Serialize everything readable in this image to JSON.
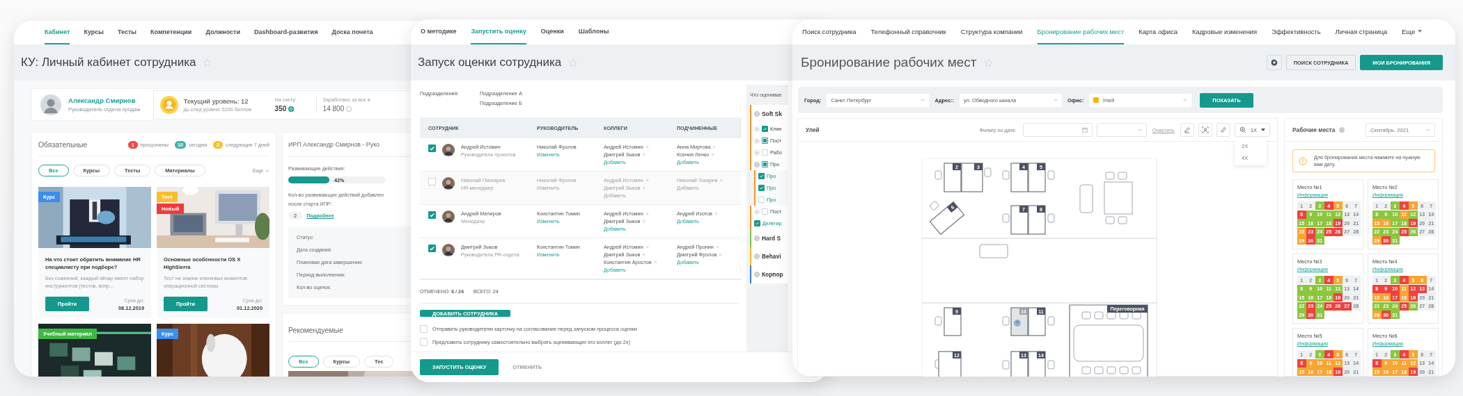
{
  "cabinet": {
    "tabs": [
      {
        "label": "Кабинет",
        "selected": true
      },
      {
        "label": "Курсы",
        "selected": false
      },
      {
        "label": "Тесты",
        "selected": false
      },
      {
        "label": "Компетенции",
        "selected": false
      },
      {
        "label": "Должности",
        "selected": false
      },
      {
        "label": "Dashboard-развития",
        "selected": false
      },
      {
        "label": "Доска почета",
        "selected": false
      }
    ],
    "title": "КУ: Личный кабинет сотрудника",
    "profile": {
      "name": "Александр Смирнов",
      "position": "Руководитель отдела продаж"
    },
    "level": {
      "title": "Текущий уровень: 12",
      "hint": "до след уровня: 5200 баллов",
      "balance_label": "На счету:",
      "balance": "350",
      "earned_label": "Заработано за все в",
      "earned": "14 800"
    },
    "required": {
      "title": "Обязательные",
      "counters": [
        {
          "count": "1",
          "label": "просрочены",
          "color": "#f04a3e"
        },
        {
          "count": "10",
          "label": "сегодня",
          "color": "#3fb3a6"
        },
        {
          "count": "2",
          "label": "следующие 7 дней",
          "color": "#f6c22e"
        }
      ],
      "filters": [
        {
          "label": "Все",
          "selected": true
        },
        {
          "label": "Курсы",
          "selected": false
        },
        {
          "label": "Тесты",
          "selected": false
        },
        {
          "label": "Материалы",
          "selected": false
        }
      ],
      "more": "Еще",
      "cards": [
        {
          "kind": "full",
          "tags": [
            {
              "label": "Курс",
              "color": "#3a8ef0"
            }
          ],
          "title": "На что стоит обратить внимание HR специалисту при подборе?",
          "text": "Без сомнений, каждый эйчар имеет набор инструментов (тестов, вопр...",
          "button": "Пройти",
          "due_label": "Срок до:",
          "due": "08.12.2019"
        },
        {
          "kind": "full",
          "tags": [
            {
              "label": "Тест",
              "color": "#f7be2f"
            },
            {
              "label": "Новый",
              "color": "#ef3b3b"
            }
          ],
          "title": "Основные особенности OS X HighSierra",
          "text": "Тест на знание ключевых моментов операционной системы",
          "button": "Пройти",
          "due_label": "Срок до:",
          "due": "01.12.2020"
        },
        {
          "kind": "picture",
          "tags": [
            {
              "label": "Учебный материал",
              "color": "#3db843"
            }
          ]
        },
        {
          "kind": "picture",
          "tags": [
            {
              "label": "Курс",
              "color": "#3a8ef0"
            }
          ]
        }
      ]
    },
    "plan": {
      "title": "ИРП Александр Смирнов - Руко",
      "actions_label": "Развивающие действия:",
      "level": 0.42,
      "percent": "42%",
      "added_lines": [
        "Кол-во развивающих действий добавлен",
        "после старта ИПР:"
      ],
      "added_count": "2",
      "more_link": "Подробнее",
      "fields": [
        "Статус:",
        "Дата создания:",
        "Плановая дата завершения:",
        "Период выполнения:",
        "Кол-во оценок:"
      ]
    },
    "recommended": {
      "title": "Рекомендуемые",
      "filters": [
        {
          "label": "Все",
          "selected": true
        },
        {
          "label": "Курсы",
          "selected": false
        },
        {
          "label": "Тес",
          "selected": false
        }
      ]
    }
  },
  "assessment": {
    "tabs": [
      {
        "label": "О методике",
        "selected": false
      },
      {
        "label": "Запустить оценку",
        "selected": true
      },
      {
        "label": "Оценки",
        "selected": false
      },
      {
        "label": "Шаблоны",
        "selected": false
      }
    ],
    "title": "Запуск оценки сотрудника",
    "departments_label": "Подразделения:",
    "departments": [
      "Подразделение А",
      "Подразделение Б"
    ],
    "columns": [
      "СОТРУДНИК",
      "РУКОВОДИТЕЛЬ",
      "КОЛЛЕГИ",
      "ПОДЧИНЕННЫЕ"
    ],
    "rows": [
      {
        "checked": true,
        "name": "Андрей Истомин",
        "position": "Руководитель проектов",
        "manager": "Николай Фролов",
        "change": "Изменить",
        "colleagues": [
          "Андрей Истомин",
          "Дмитрий Зыков"
        ],
        "colleagues_add": "Добавить",
        "subordinates": [
          "Анна Миртова",
          "Ксения Ленко"
        ],
        "subordinates_add": "Добавить"
      },
      {
        "checked": false,
        "name": "Николай Пискарев",
        "position": "HR-менеджер",
        "manager": "Николай Фролов",
        "change": "Изменить",
        "colleagues": [
          "Андрей Истомин",
          "Дмитрий Зыков"
        ],
        "colleagues_add": "Добавить",
        "subordinates": [
          "Николай Токарев"
        ],
        "subordinates_add": "Добавить"
      },
      {
        "checked": true,
        "name": "Андрей Мелиров",
        "position": "Менеджер",
        "manager": "Константин Томин",
        "change": "Изменить",
        "colleagues": [
          "Андрей Истомин",
          "Дмитрий Зыков"
        ],
        "colleagues_add": "Добавить",
        "subordinates": [
          "Андрей Изотов"
        ],
        "subordinates_add": "Добавить"
      },
      {
        "checked": true,
        "name": "Дмитрий Зыков",
        "position": "Руководитель PR-отдела",
        "manager": "Константин Томин",
        "change": "Изменить",
        "colleagues": [
          "Андрей Истомин",
          "Дмитрий Зыков",
          "Константин Аростов"
        ],
        "colleagues_add": "Добавить",
        "subordinates": [
          "Андрей Пронин",
          "Дмитрий Фролов"
        ],
        "subordinates_add": "Добавить"
      }
    ],
    "marked": "ОТМЕЧЕНО: **6 / 24**",
    "total": "ВСЕГО: 24",
    "add_button": "ДОБАВИТЬ СОТРУДНИКА",
    "options": [
      {
        "label": "Отправить руководителю карточку на согласование перед запуском процесса оценки",
        "checked": false
      },
      {
        "label": "Предложить сотруднику самостоятельно выбрать оценивающих его коллег (до 2х)",
        "checked": false
      }
    ],
    "start_button": "ЗАПУСТИТЬ ОЦЕНКУ",
    "cancel_button": "ОТМЕНИТЬ",
    "criteria": {
      "title": "Что оценивае",
      "groups": [
        {
          "label": "Soft Sk",
          "color": "#f7941d",
          "expanded": true,
          "children": [
            {
              "label": "Клие",
              "expanded": false,
              "checked": true
            },
            {
              "label": "Пост",
              "expanded": false,
              "checked": false,
              "partial": true
            },
            {
              "label": "Рабо",
              "expanded": false,
              "checked": false,
              "partial": false
            },
            {
              "label": "Про",
              "expanded": true,
              "checked": false,
              "partial": true,
              "children": [
                {
                  "label": "Про",
                  "checked": true
                },
                {
                  "label": "Про",
                  "checked": true
                },
                {
                  "label": "Про",
                  "checked": false,
                  "partial": false
                }
              ]
            },
            {
              "label": "Пост",
              "expanded": false,
              "checked": false,
              "partial": false
            },
            {
              "label": "Делегир",
              "checked": true
            }
          ]
        },
        {
          "label": "Hard S",
          "color": "#7cc242",
          "expanded": true
        },
        {
          "label": "Behavi",
          "color": "#f9b91d",
          "expanded": true
        },
        {
          "label": "Корпор",
          "color": "#3d7be0",
          "expanded": true
        }
      ]
    }
  },
  "booking": {
    "tabs": [
      {
        "label": "Поиск сотрудника",
        "selected": false
      },
      {
        "label": "Телефонный справочник",
        "selected": false
      },
      {
        "label": "Структура компании",
        "selected": false
      },
      {
        "label": "Бронирование рабочих мест",
        "selected": true
      },
      {
        "label": "Карта офиса",
        "selected": false
      },
      {
        "label": "Кадровые изменения",
        "selected": false
      },
      {
        "label": "Эффективность",
        "selected": false
      },
      {
        "label": "Личная страница",
        "selected": false
      },
      {
        "label": "Еще",
        "selected": false
      }
    ],
    "title": "Бронирование рабочих мест",
    "search_button": "ПОИСК СОТРУДНИКА",
    "bookings_button": "МОИ БРОНИРОВАНИЯ",
    "filters": [
      {
        "label": "Город:",
        "value": "Санкт-Петербург"
      },
      {
        "label": "Адрес::",
        "value": "ул. Обводного канала"
      },
      {
        "label": "Офис:",
        "value": "Улей",
        "color": "#f7b500"
      }
    ],
    "show_button": "ПОКАЗАТЬ",
    "map": {
      "title": "Улей",
      "date_label": "Фильтр по дате:",
      "clear": "Очистить",
      "zoom": "1X",
      "zoom_options": [
        "2X",
        "4X"
      ],
      "desks": [
        {
          "number": "2",
          "occupied": false
        },
        {
          "number": "3",
          "occupied": false
        },
        {
          "number": "4",
          "occupied": false
        },
        {
          "number": "5",
          "occupied": false
        },
        {
          "number": "6",
          "occupied": false
        },
        {
          "number": "7",
          "occupied": false
        },
        {
          "number": "8",
          "occupied": false
        },
        {
          "number": "9",
          "occupied": false
        },
        {
          "number": "10",
          "occupied": true
        },
        {
          "number": "11",
          "occupied": false
        },
        {
          "number": "12",
          "occupied": false
        },
        {
          "number": "13",
          "occupied": false
        },
        {
          "number": "14",
          "occupied": false
        }
      ],
      "meeting_room": "Переговорная"
    },
    "sidebar": {
      "title": "Рабочие места",
      "month": "Сентябрь, 2021",
      "notice": "Для бронирования места нажмите на нужную вам дату.",
      "places": [
        {
          "title": "Место №1",
          "link": "Информация",
          "days": [
            {
              "d": "1",
              "color": "#eef0f2"
            },
            {
              "d": "2",
              "color": "#eef0f2"
            },
            {
              "d": "3",
              "color": "#8cc63f"
            },
            {
              "d": "4",
              "color": "#f0413f"
            },
            {
              "d": "5",
              "color": "#f8a531"
            },
            {
              "d": "6",
              "color": "#eef0f2"
            },
            {
              "d": "7",
              "color": "#eef0f2"
            },
            {
              "d": "8",
              "color": "#f0413f"
            },
            {
              "d": "9",
              "color": "#8cc63f"
            },
            {
              "d": "10",
              "color": "#8cc63f"
            },
            {
              "d": "11",
              "color": "#8cc63f"
            },
            {
              "d": "12",
              "color": "#8cc63f"
            },
            {
              "d": "13",
              "color": "#eef0f2"
            },
            {
              "d": "14",
              "color": "#eef0f2"
            },
            {
              "d": "15",
              "color": "#8cc63f"
            },
            {
              "d": "16",
              "color": "#8cc63f"
            },
            {
              "d": "17",
              "color": "#8cc63f"
            },
            {
              "d": "18",
              "color": "#8cc63f"
            },
            {
              "d": "19",
              "color": "#f0413f"
            },
            {
              "d": "20",
              "color": "#eef0f2"
            },
            {
              "d": "21",
              "color": "#eef0f2"
            },
            {
              "d": "22",
              "color": "#f8a531"
            },
            {
              "d": "23",
              "color": "#f0413f"
            },
            {
              "d": "24",
              "color": "#8cc63f"
            },
            {
              "d": "25",
              "color": "#f0413f"
            },
            {
              "d": "26",
              "color": "#f0413f"
            },
            {
              "d": "27",
              "color": "#eef0f2"
            },
            {
              "d": "28",
              "color": "#eef0f2"
            },
            {
              "d": "29",
              "color": "#f8a531"
            },
            {
              "d": "30",
              "color": "#f0413f"
            },
            {
              "d": "31",
              "color": "#8cc63f"
            }
          ]
        },
        {
          "title": "Место №2",
          "link": "Информация",
          "days": [
            {
              "d": "1",
              "color": "#eef0f2"
            },
            {
              "d": "2",
              "color": "#eef0f2"
            },
            {
              "d": "3",
              "color": "#8cc63f"
            },
            {
              "d": "4",
              "color": "#f0413f"
            },
            {
              "d": "5",
              "color": "#f8a531"
            },
            {
              "d": "6",
              "color": "#eef0f2"
            },
            {
              "d": "7",
              "color": "#eef0f2"
            },
            {
              "d": "8",
              "color": "#8cc63f"
            },
            {
              "d": "9",
              "color": "#8cc63f"
            },
            {
              "d": "10",
              "color": "#8cc63f"
            },
            {
              "d": "11",
              "color": "#f8a531"
            },
            {
              "d": "12",
              "color": "#8cc63f"
            },
            {
              "d": "13",
              "color": "#eef0f2"
            },
            {
              "d": "14",
              "color": "#eef0f2"
            },
            {
              "d": "15",
              "color": "#f8a531"
            },
            {
              "d": "16",
              "color": "#f8a531"
            },
            {
              "d": "17",
              "color": "#8cc63f"
            },
            {
              "d": "18",
              "color": "#8cc63f"
            },
            {
              "d": "19",
              "color": "#f0413f"
            },
            {
              "d": "20",
              "color": "#eef0f2"
            },
            {
              "d": "21",
              "color": "#eef0f2"
            },
            {
              "d": "22",
              "color": "#8cc63f"
            },
            {
              "d": "23",
              "color": "#8cc63f"
            },
            {
              "d": "24",
              "color": "#8cc63f"
            },
            {
              "d": "25",
              "color": "#f0413f"
            },
            {
              "d": "26",
              "color": "#8cc63f"
            },
            {
              "d": "27",
              "color": "#eef0f2"
            },
            {
              "d": "28",
              "color": "#eef0f2"
            },
            {
              "d": "29",
              "color": "#f8a531"
            },
            {
              "d": "30",
              "color": "#f0413f"
            },
            {
              "d": "31",
              "color": "#8cc63f"
            }
          ]
        },
        {
          "title": "Место №3",
          "link": "Информация",
          "days": [
            {
              "d": "1",
              "color": "#eef0f2"
            },
            {
              "d": "2",
              "color": "#eef0f2"
            },
            {
              "d": "3",
              "color": "#8cc63f"
            },
            {
              "d": "4",
              "color": "#f0413f"
            },
            {
              "d": "5",
              "color": "#f8a531"
            },
            {
              "d": "6",
              "color": "#eef0f2"
            },
            {
              "d": "7",
              "color": "#eef0f2"
            },
            {
              "d": "8",
              "color": "#8cc63f"
            },
            {
              "d": "9",
              "color": "#8cc63f"
            },
            {
              "d": "10",
              "color": "#8cc63f"
            },
            {
              "d": "11",
              "color": "#8cc63f"
            },
            {
              "d": "12",
              "color": "#8cc63f"
            },
            {
              "d": "13",
              "color": "#eef0f2"
            },
            {
              "d": "14",
              "color": "#eef0f2"
            },
            {
              "d": "15",
              "color": "#8cc63f"
            },
            {
              "d": "16",
              "color": "#8cc63f"
            },
            {
              "d": "17",
              "color": "#8cc63f"
            },
            {
              "d": "18",
              "color": "#8cc63f"
            },
            {
              "d": "19",
              "color": "#f0413f"
            },
            {
              "d": "20",
              "color": "#eef0f2"
            },
            {
              "d": "21",
              "color": "#eef0f2"
            },
            {
              "d": "22",
              "color": "#8cc63f"
            },
            {
              "d": "23",
              "color": "#f0413f"
            },
            {
              "d": "24",
              "color": "#8cc63f"
            },
            {
              "d": "25",
              "color": "#f0413f"
            },
            {
              "d": "26",
              "color": "#f0413f"
            },
            {
              "d": "27",
              "color": "#f0413f"
            },
            {
              "d": "28",
              "color": "#eef0f2"
            },
            {
              "d": "29",
              "color": "#8cc63f"
            },
            {
              "d": "30",
              "color": "#f0413f"
            },
            {
              "d": "31",
              "color": "#8cc63f"
            }
          ]
        },
        {
          "title": "Место №4",
          "link": "Информация",
          "days": [
            {
              "d": "1",
              "color": "#eef0f2"
            },
            {
              "d": "2",
              "color": "#eef0f2"
            },
            {
              "d": "3",
              "color": "#8cc63f"
            },
            {
              "d": "4",
              "color": "#f0413f"
            },
            {
              "d": "5",
              "color": "#f8a531"
            },
            {
              "d": "6",
              "color": "#f8a531"
            },
            {
              "d": "7",
              "color": "#eef0f2"
            },
            {
              "d": "8",
              "color": "#f0413f"
            },
            {
              "d": "9",
              "color": "#f0413f"
            },
            {
              "d": "10",
              "color": "#f0413f"
            },
            {
              "d": "11",
              "color": "#f8a531"
            },
            {
              "d": "12",
              "color": "#f0413f"
            },
            {
              "d": "13",
              "color": "#f0413f"
            },
            {
              "d": "14",
              "color": "#eef0f2"
            },
            {
              "d": "15",
              "color": "#f8a531"
            },
            {
              "d": "16",
              "color": "#f8a531"
            },
            {
              "d": "17",
              "color": "#f0413f"
            },
            {
              "d": "18",
              "color": "#f8a531"
            },
            {
              "d": "19",
              "color": "#f0413f"
            },
            {
              "d": "20",
              "color": "#eef0f2"
            },
            {
              "d": "21",
              "color": "#eef0f2"
            },
            {
              "d": "22",
              "color": "#8cc63f"
            },
            {
              "d": "23",
              "color": "#8cc63f"
            },
            {
              "d": "24",
              "color": "#8cc63f"
            },
            {
              "d": "25",
              "color": "#f0413f"
            },
            {
              "d": "26",
              "color": "#8cc63f"
            },
            {
              "d": "27",
              "color": "#eef0f2"
            },
            {
              "d": "28",
              "color": "#eef0f2"
            },
            {
              "d": "29",
              "color": "#f8a531"
            },
            {
              "d": "30",
              "color": "#f0413f"
            },
            {
              "d": "31",
              "color": "#8cc63f"
            }
          ]
        },
        {
          "title": "Место №5",
          "link": "Информация",
          "days": [
            {
              "d": "1",
              "color": "#eef0f2"
            },
            {
              "d": "2",
              "color": "#eef0f2"
            },
            {
              "d": "3",
              "color": "#8cc63f"
            },
            {
              "d": "4",
              "color": "#f0413f"
            },
            {
              "d": "5",
              "color": "#f8a531"
            },
            {
              "d": "6",
              "color": "#eef0f2"
            },
            {
              "d": "7",
              "color": "#eef0f2"
            },
            {
              "d": "8",
              "color": "#f0413f"
            },
            {
              "d": "9",
              "color": "#f8a531"
            },
            {
              "d": "10",
              "color": "#f8a531"
            },
            {
              "d": "11",
              "color": "#f8a531"
            },
            {
              "d": "12",
              "color": "#f8a531"
            },
            {
              "d": "13",
              "color": "#eef0f2"
            },
            {
              "d": "14",
              "color": "#eef0f2"
            },
            {
              "d": "15",
              "color": "#f8a531"
            },
            {
              "d": "16",
              "color": "#f8a531"
            },
            {
              "d": "17",
              "color": "#f8a531"
            },
            {
              "d": "18",
              "color": "#f8a531"
            },
            {
              "d": "19",
              "color": "#f0413f"
            },
            {
              "d": "20",
              "color": "#eef0f2"
            },
            {
              "d": "21",
              "color": "#eef0f2"
            }
          ]
        },
        {
          "title": "Место №6",
          "link": "Информация",
          "days": [
            {
              "d": "1",
              "color": "#eef0f2"
            },
            {
              "d": "2",
              "color": "#eef0f2"
            },
            {
              "d": "3",
              "color": "#8cc63f"
            },
            {
              "d": "4",
              "color": "#f0413f"
            },
            {
              "d": "5",
              "color": "#f8a531"
            },
            {
              "d": "6",
              "color": "#eef0f2"
            },
            {
              "d": "7",
              "color": "#eef0f2"
            },
            {
              "d": "8",
              "color": "#f0413f"
            },
            {
              "d": "9",
              "color": "#f8a531"
            },
            {
              "d": "10",
              "color": "#f8a531"
            },
            {
              "d": "11",
              "color": "#f8a531"
            },
            {
              "d": "12",
              "color": "#f8a531"
            },
            {
              "d": "13",
              "color": "#eef0f2"
            },
            {
              "d": "14",
              "color": "#eef0f2"
            },
            {
              "d": "15",
              "color": "#f8a531"
            },
            {
              "d": "16",
              "color": "#f8a531"
            },
            {
              "d": "17",
              "color": "#f8a531"
            },
            {
              "d": "18",
              "color": "#f8a531"
            },
            {
              "d": "19",
              "color": "#f0413f"
            },
            {
              "d": "20",
              "color": "#eef0f2"
            },
            {
              "d": "21",
              "color": "#eef0f2"
            }
          ]
        }
      ]
    }
  }
}
